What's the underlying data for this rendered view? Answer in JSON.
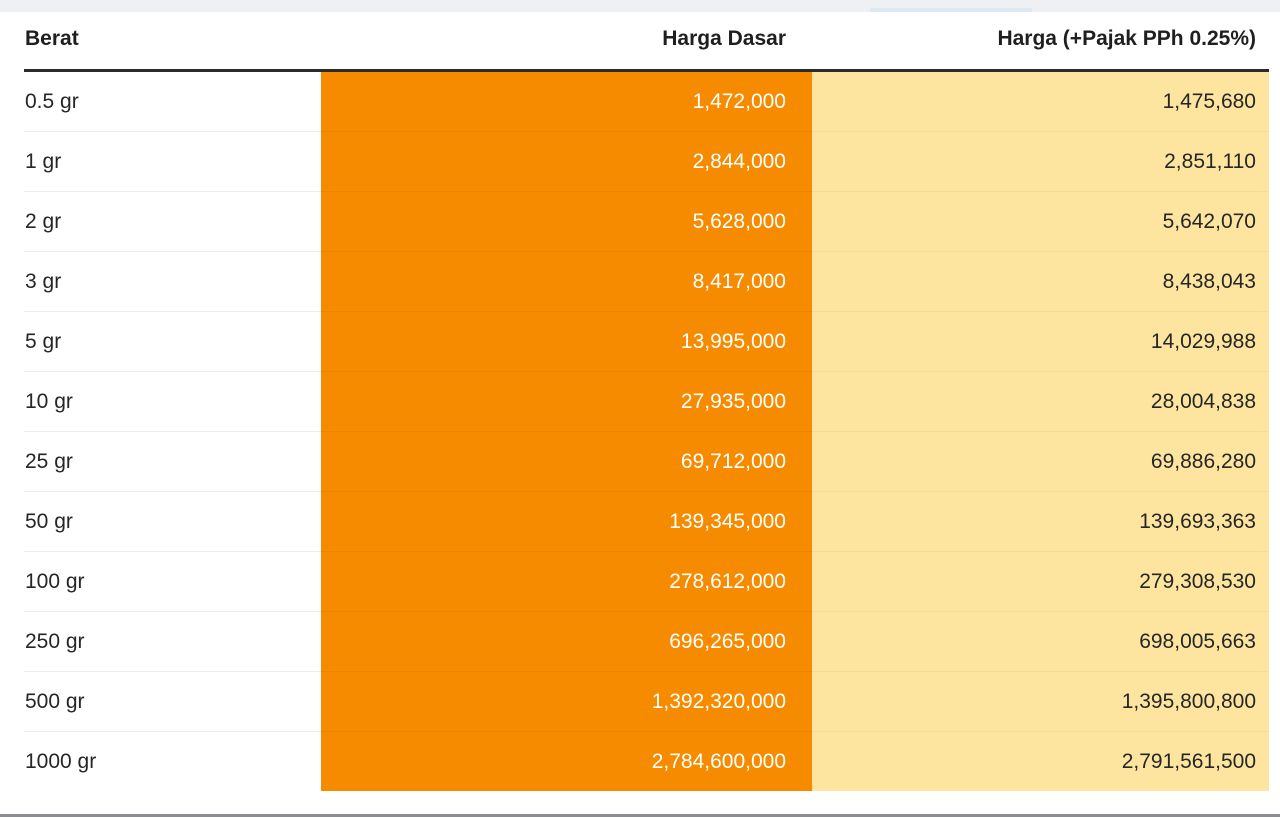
{
  "table": {
    "headers": {
      "weight": "Berat",
      "base_price": "Harga Dasar",
      "price_with_tax": "Harga (+Pajak PPh 0.25%)"
    },
    "rows": [
      {
        "weight": "0.5 gr",
        "base_price": "1,472,000",
        "price_with_tax": "1,475,680"
      },
      {
        "weight": "1 gr",
        "base_price": "2,844,000",
        "price_with_tax": "2,851,110"
      },
      {
        "weight": "2 gr",
        "base_price": "5,628,000",
        "price_with_tax": "5,642,070"
      },
      {
        "weight": "3 gr",
        "base_price": "8,417,000",
        "price_with_tax": "8,438,043"
      },
      {
        "weight": "5 gr",
        "base_price": "13,995,000",
        "price_with_tax": "14,029,988"
      },
      {
        "weight": "10 gr",
        "base_price": "27,935,000",
        "price_with_tax": "28,004,838"
      },
      {
        "weight": "25 gr",
        "base_price": "69,712,000",
        "price_with_tax": "69,886,280"
      },
      {
        "weight": "50 gr",
        "base_price": "139,345,000",
        "price_with_tax": "139,693,363"
      },
      {
        "weight": "100 gr",
        "base_price": "278,612,000",
        "price_with_tax": "279,308,530"
      },
      {
        "weight": "250 gr",
        "base_price": "696,265,000",
        "price_with_tax": "698,005,663"
      },
      {
        "weight": "500 gr",
        "base_price": "1,392,320,000",
        "price_with_tax": "1,395,800,800"
      },
      {
        "weight": "1000 gr",
        "base_price": "2,784,600,000",
        "price_with_tax": "2,791,561,500"
      }
    ]
  },
  "colors": {
    "base_column_bg": "#f78b00",
    "tax_column_bg": "#fde59f",
    "header_rule": "#2b2b2b"
  }
}
